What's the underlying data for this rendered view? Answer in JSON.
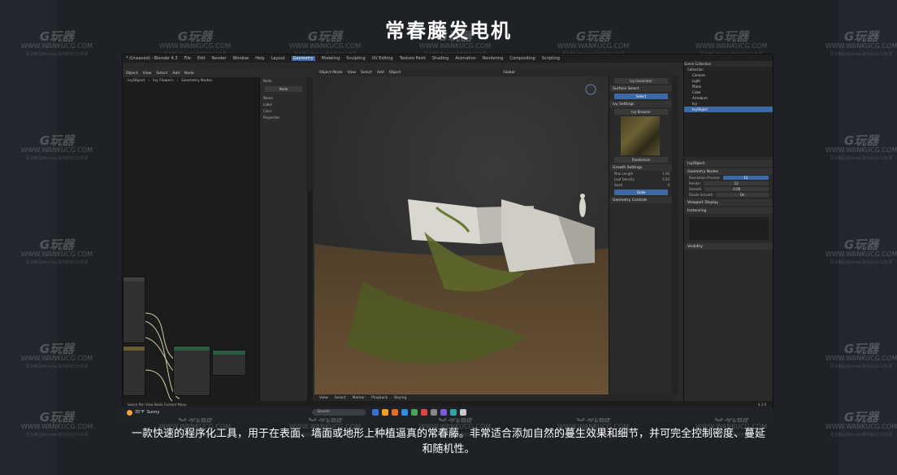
{
  "page": {
    "title": "常春藤发电机",
    "caption": "一款快速的程序化工具，用于在表面、墙面或地形上种植逼真的常春藤。非常适合添加自然的蔓生效果和细节，并可完全控制密度、蔓延和随机性。"
  },
  "watermark": {
    "logo": "G玩器",
    "url": "WWW.WANKUCG.COM",
    "sub": "更多精品Blender素材就在CG资源"
  },
  "blender": {
    "window_title": "* (Unsaved) - Blender 4.3",
    "menus": [
      "File",
      "Edit",
      "Render",
      "Window",
      "Help"
    ],
    "workspaces": [
      "Layout",
      "Geometry",
      "Modeling",
      "Sculpting",
      "UV Editing",
      "Texture Paint",
      "Shading",
      "Animation",
      "Rendering",
      "Compositing",
      "Scripting"
    ],
    "active_workspace": "Geometry",
    "node_editor": {
      "header": [
        "Object",
        "View",
        "Select",
        "Add",
        "Node"
      ],
      "breadcrumb": [
        "IvyObject",
        "Ivy Flowers",
        "Geometry Nodes"
      ],
      "panel_items": [
        "Node",
        "Name",
        "Label",
        "Color",
        "Properties"
      ],
      "panel_button": "Node"
    },
    "viewport": {
      "header": [
        "Object Mode",
        "View",
        "Select",
        "Add",
        "Object"
      ],
      "footer": [
        "View",
        "Select",
        "Marker",
        "Playback",
        "Keying"
      ],
      "overlay_label": "Global"
    },
    "npanel": {
      "title": "Ivy Generator",
      "sections": [
        "Surface Select",
        "Ivy Settings",
        "Growth Settings",
        "Geometry Controls"
      ],
      "buttons": [
        "Select",
        "Randomize",
        "Grow"
      ],
      "rows": [
        {
          "label": "Max Length",
          "value": "1.00"
        },
        {
          "label": "Leaf Density",
          "value": "0.50"
        },
        {
          "label": "Seed",
          "value": "0"
        }
      ],
      "tex_browser": "Ivy Browser"
    },
    "outliner": {
      "header": "Scene Collection",
      "items": [
        "Collection",
        "Camera",
        "Light",
        "Plane",
        "Cube",
        "Armature",
        "Ivy",
        "IvyObject"
      ],
      "selected": "IvyObject"
    },
    "properties": {
      "object": "IvyObject",
      "sections": [
        "Geometry Nodes",
        "Viewport Display",
        "Instancing",
        "Visibility"
      ],
      "rows": [
        {
          "label": "Resolution Preview",
          "value": "12"
        },
        {
          "label": "Render",
          "value": "12"
        },
        {
          "label": "Smooth",
          "value": "0.00"
        },
        {
          "label": "Shade Smooth",
          "value": "On"
        }
      ]
    },
    "status": "Select  Pan View  Node Context Menu",
    "version": "4.3.0"
  },
  "taskbar": {
    "weather_temp": "35°F",
    "weather_text": "Sunny",
    "search_placeholder": "Search"
  },
  "colors": {
    "accent": "#3d6aa5",
    "sun": "#f2a33a"
  }
}
